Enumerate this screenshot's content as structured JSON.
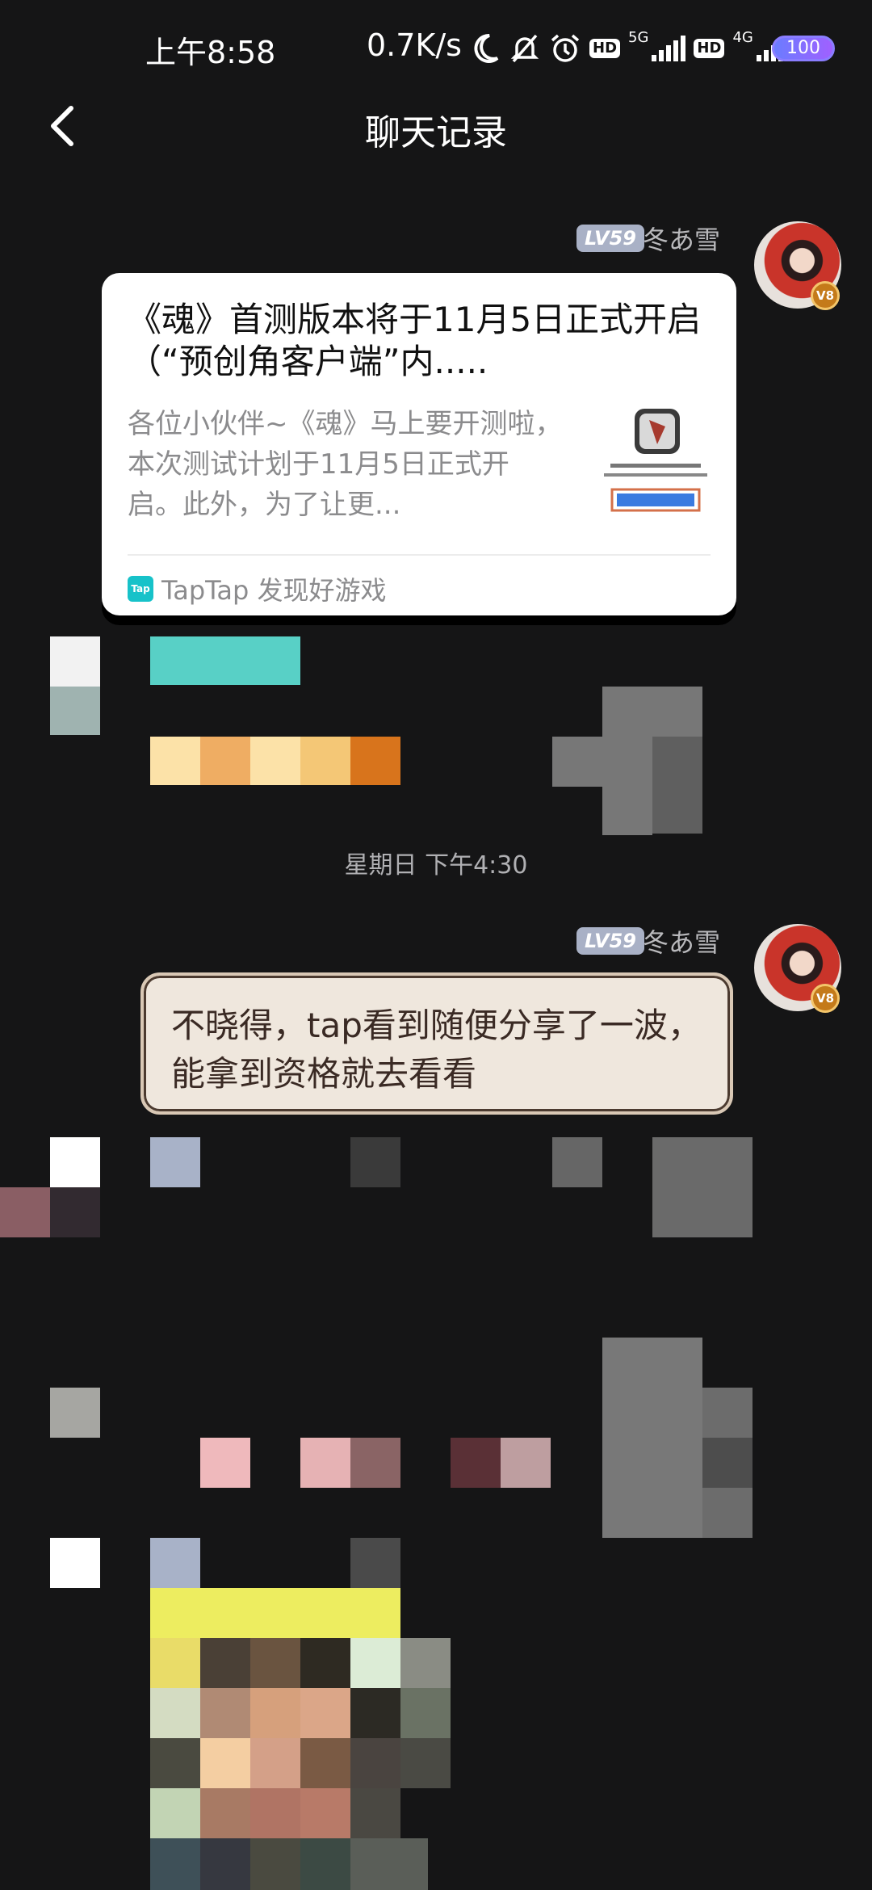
{
  "status_bar": {
    "time": "上午8:58",
    "network_speed": "0.7K/s",
    "icons": [
      "moon-icon",
      "bell-off-icon",
      "alarm-icon",
      "hd-icon",
      "signal-5g-icon",
      "hd-icon",
      "signal-4g-icon"
    ],
    "net_labels": [
      "5G",
      "4G"
    ],
    "hd_label": "HD",
    "battery": "100"
  },
  "header": {
    "title": "聊天记录"
  },
  "messages": [
    {
      "sender": {
        "level": "LV59",
        "name": "冬あ雪",
        "vip": "V8"
      },
      "share_card": {
        "title": "《魂》首测版本将于11月5日正式开启（“预创角客户端”内.....",
        "description": "各位小伙伴~《魂》马上要开测啦，本次测试计划于11月5日正式开启。此外，为了让更...",
        "source": "TapTap 发现好游戏",
        "source_logo": "Tap"
      }
    },
    {
      "timestamp": "星期日 下午4:30"
    },
    {
      "sender": {
        "level": "LV59",
        "name": "冬あ雪",
        "vip": "V8"
      },
      "text": "不晓得，tap看到随便分享了一波，能拿到资格就去看看"
    }
  ],
  "colors": {
    "background": "#151516",
    "level_badge": "#a9b1c6",
    "bubble": "#efe7dd",
    "taptap": "#17c2c9",
    "battery": "#8a7dff"
  }
}
